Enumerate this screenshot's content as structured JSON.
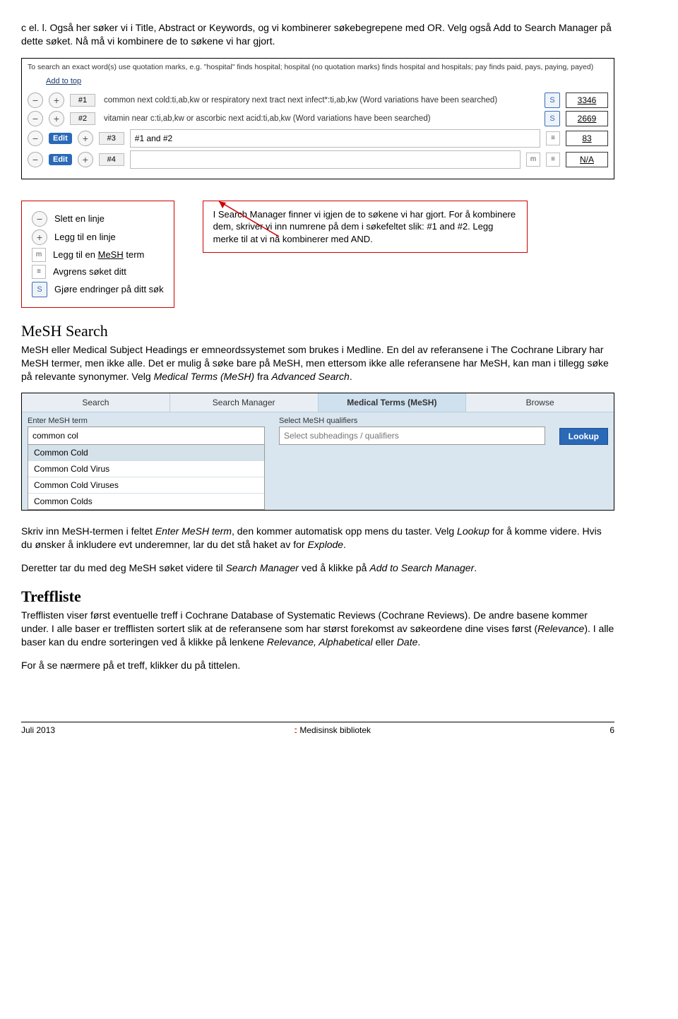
{
  "intro": "c el. l. Også her søker vi i Title, Abstract or Keywords, og vi kombinerer søkebegrepene med OR. Velg også Add to Search Manager på dette søket. Nå må vi kombinere de to søkene vi har gjort.",
  "searchHelp": "To search an exact word(s) use quotation marks, e.g. \"hospital\" finds hospital; hospital (no quotation marks) finds hospital and hospitals; pay finds paid, pays, paying, payed)",
  "addToTop": "Add to top",
  "rows": [
    {
      "n": "#1",
      "q": "common next cold:ti,ab,kw or respiratory next tract next infect*:ti,ab,kw (Word variations have been searched)",
      "s": true,
      "count": "3346"
    },
    {
      "n": "#2",
      "q": "vitamin near c:ti,ab,kw or ascorbic next acid:ti,ab,kw (Word variations have been searched)",
      "s": true,
      "count": "2669"
    },
    {
      "n": "#3",
      "q": "#1 and #2",
      "edit": true,
      "input": true,
      "limit": true,
      "count": "83"
    },
    {
      "n": "#4",
      "q": "",
      "edit": true,
      "input": true,
      "m": true,
      "limit": true,
      "count": "N/A"
    }
  ],
  "legend": {
    "del": "Slett en linje",
    "add": "Legg til en linje",
    "mesh": "Legg til en MeSH term",
    "limit": "Avgrens søket ditt",
    "s": "Gjøre endringer på ditt søk"
  },
  "callout": "I Search Manager finner vi igjen de to søkene vi har gjort. For å kombinere dem, skriver vi inn numrene på dem i søkefeltet slik: #1 and #2. Legg merke til at vi nå kombinerer med AND.",
  "meshHeading": "MeSH Search",
  "meshPara": "MeSH eller Medical Subject Headings er emneordssystemet som brukes i Medline. En del av referansene i The Cochrane Library har MeSH termer, men ikke alle. Det er mulig å søke bare på MeSH, men ettersom ikke alle referansene har MeSH, kan man i tillegg søke på relevante synonymer. Velg Medical Terms (MeSH) fra Advanced Search.",
  "tabs": {
    "search": "Search",
    "manager": "Search Manager",
    "mesh": "Medical Terms (MeSH)",
    "browse": "Browse"
  },
  "meshForm": {
    "enterLabel": "Enter MeSH term",
    "enterValue": "common col",
    "qualLabel": "Select MeSH qualifiers",
    "qualPlaceholder": "Select subheadings / qualifiers",
    "lookup": "Lookup",
    "suggestions": [
      "Common Cold",
      "Common Cold Virus",
      "Common Cold Viruses",
      "Common Colds"
    ]
  },
  "afterMesh1": "Skriv inn MeSH-termen i feltet Enter MeSH term, den kommer automatisk opp mens du taster. Velg Lookup for å komme videre. Hvis du ønsker å inkludere evt underemner, lar du det stå haket av for Explode.",
  "afterMesh2": "Deretter tar du med deg MeSH søket videre til Search Manager ved å klikke på Add to Search Manager.",
  "treffHeading": "Treffliste",
  "treffPara1": "Trefflisten viser først eventuelle treff i Cochrane Database of Systematic Reviews (Cochrane Reviews). De andre basene kommer under. I alle baser er trefflisten sortert slik at de referansene som har størst forekomst av søkeordene dine vises først (Relevance). I alle baser kan du endre sorteringen ved å klikke på lenkene Relevance, Alphabetical eller Date.",
  "treffPara2": "For å se nærmere på et treff, klikker du på tittelen.",
  "footer": {
    "left": "Juli 2013",
    "mid": "Medisinsk bibliotek",
    "page": "6"
  }
}
